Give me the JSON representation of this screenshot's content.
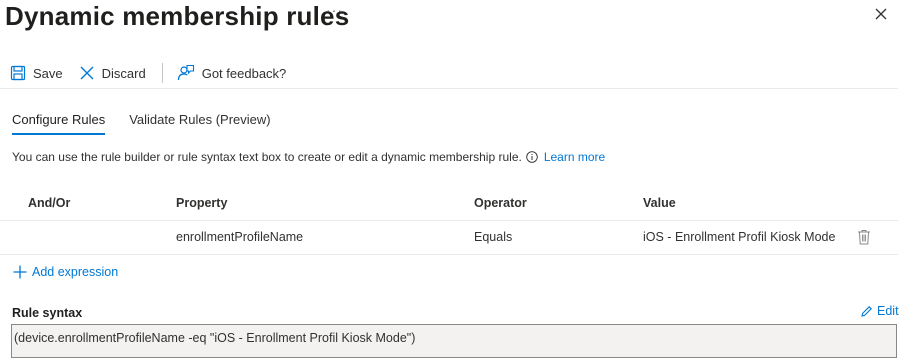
{
  "header": {
    "title": "Dynamic membership rules",
    "more_label": "···"
  },
  "toolbar": {
    "save_label": "Save",
    "discard_label": "Discard",
    "feedback_label": "Got feedback?"
  },
  "tabs": [
    {
      "label": "Configure Rules",
      "active": true
    },
    {
      "label": "Validate Rules (Preview)",
      "active": false
    }
  ],
  "info": {
    "text": "You can use the rule builder or rule syntax text box to create or edit a dynamic membership rule.",
    "link": "Learn more"
  },
  "table": {
    "headers": [
      "And/Or",
      "Property",
      "Operator",
      "Value"
    ],
    "rows": [
      {
        "and_or": "",
        "property": "enrollmentProfileName",
        "operator": "Equals",
        "value": "iOS - Enrollment Profil Kiosk Mode"
      }
    ]
  },
  "add_expression_label": "Add expression",
  "rule_syntax": {
    "label": "Rule syntax",
    "edit_label": "Edit",
    "value": "(device.enrollmentProfileName -eq \"iOS - Enrollment Profil Kiosk Mode\")"
  },
  "colors": {
    "accent": "#0078d4",
    "text": "#323130",
    "border": "#edebe9"
  }
}
